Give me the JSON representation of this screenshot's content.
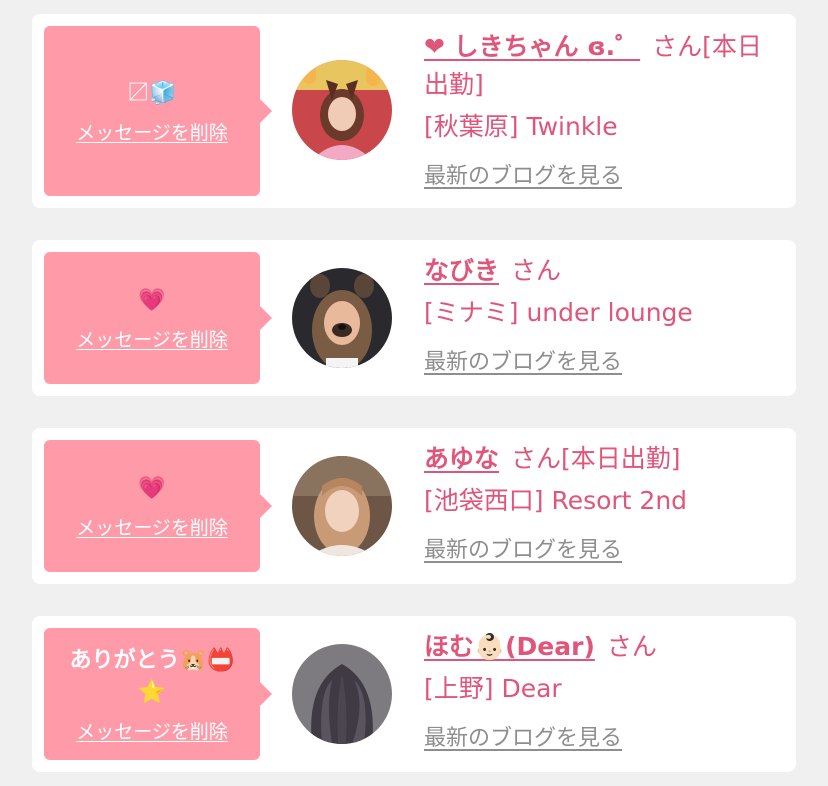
{
  "colors": {
    "page_background": "#f0f0f0",
    "card_background": "#ffffff",
    "bubble_pink": "#ff9aa9",
    "name_pink": "#e0557a",
    "link_gray": "#8e8e8e"
  },
  "entries": [
    {
      "name": "❤ しきちゃん ɞ.゜",
      "suffix": "さん[本日出勤]",
      "shop": "[秋葉原] Twinkle",
      "message": "〼🧊",
      "delete_label": "メッセージを削除",
      "blog_link": "最新のブログを見る",
      "avatar_icon": "photo-avatar"
    },
    {
      "name": "なびき",
      "suffix": "さん",
      "shop": "[ミナミ] under lounge",
      "message": "💗",
      "delete_label": "メッセージを削除",
      "blog_link": "最新のブログを見る",
      "avatar_icon": "photo-avatar"
    },
    {
      "name": "あゆな",
      "suffix": "さん[本日出勤]",
      "shop": "[池袋西口] Resort 2nd",
      "message": "💗",
      "delete_label": "メッセージを削除",
      "blog_link": "最新のブログを見る",
      "avatar_icon": "photo-avatar"
    },
    {
      "name": "ほむ👶🏻(Dear)",
      "suffix": "さん",
      "shop": "[上野] Dear",
      "message": "ありがとう🐹📛\n⭐",
      "delete_label": "メッセージを削除",
      "blog_link": "最新のブログを見る",
      "avatar_icon": "photo-avatar"
    }
  ]
}
